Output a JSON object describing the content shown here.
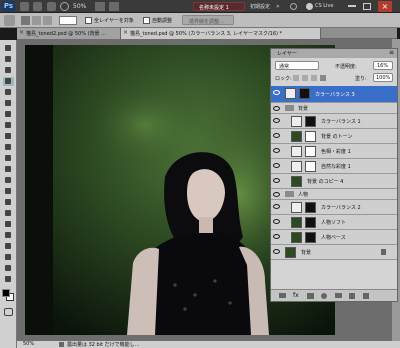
{
  "app": {
    "logo": "Ps",
    "zoom": "50%",
    "workspace_button": "名称未設定 1",
    "workspace_initial": "初期設定",
    "live_label": "CS Live"
  },
  "options": {
    "all_layers": "全レイヤーを対象",
    "auto_adjust": "自動調整",
    "refine_edge": "境界線を調整..."
  },
  "tabs": [
    {
      "label": "猫島_toned2.psd @ 50% (背景 ..."
    },
    {
      "label": "猫島_toned.psd @ 50% (カラーバランス 3, レイヤーマスク/16) *"
    }
  ],
  "layers_panel": {
    "title": "レイヤー",
    "blend_mode": "通常",
    "opacity_label": "不透明度:",
    "opacity_value": "16%",
    "lock_label": "ロック:",
    "fill_label": "塗り:",
    "fill_value": "100%",
    "layers": [
      {
        "name": "カラーバランス 3",
        "selected": true,
        "kind": "adjust"
      },
      {
        "name": "背景",
        "selected": false,
        "kind": "group"
      },
      {
        "name": "カラーバランス 1",
        "selected": false,
        "kind": "adjust"
      },
      {
        "name": "背景 のトーン",
        "selected": false,
        "kind": "image"
      },
      {
        "name": "色相・彩度 1",
        "selected": false,
        "kind": "adjust"
      },
      {
        "name": "自然な彩度 1",
        "selected": false,
        "kind": "adjust"
      },
      {
        "name": "背景 のコピー 4",
        "selected": false,
        "kind": "image"
      },
      {
        "name": "人物",
        "selected": false,
        "kind": "group"
      },
      {
        "name": "カラーバランス 2",
        "selected": false,
        "kind": "adjust"
      },
      {
        "name": "人物ソフト",
        "selected": false,
        "kind": "image"
      },
      {
        "name": "人物ベース",
        "selected": false,
        "kind": "image"
      },
      {
        "name": "背景",
        "selected": false,
        "kind": "image"
      }
    ]
  },
  "status": {
    "zoom": "50%",
    "message": "露出量は 32 bit だけで機能し..."
  },
  "colors": {
    "selection": "#3a6fc9",
    "moss": "#2d4a22"
  }
}
